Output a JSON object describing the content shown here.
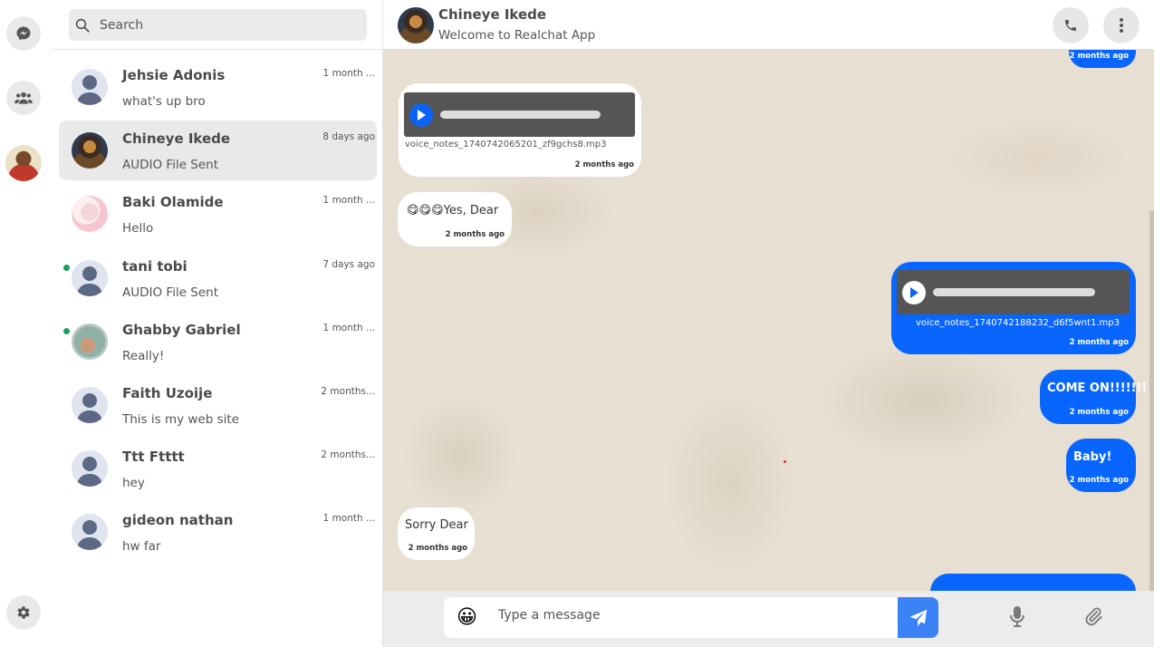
{
  "search": {
    "placeholder": "Search"
  },
  "contacts": [
    {
      "name": "Jehsie Adonis",
      "preview": "what's up bro",
      "time": "1 month ...",
      "online": false,
      "active": false
    },
    {
      "name": "Chineye Ikede",
      "preview": "AUDIO File Sent",
      "time": "8 days ago",
      "online": false,
      "active": true
    },
    {
      "name": "Baki Olamide",
      "preview": "Hello",
      "time": "1 month ...",
      "online": false,
      "active": false
    },
    {
      "name": "tani tobi",
      "preview": "AUDIO File Sent",
      "time": "7 days ago",
      "online": true,
      "active": false
    },
    {
      "name": "Ghabby Gabriel",
      "preview": "Really!",
      "time": "1 month ...",
      "online": true,
      "active": false
    },
    {
      "name": "Faith Uzoije",
      "preview": "This is my web site",
      "time": "2 months...",
      "online": false,
      "active": false
    },
    {
      "name": "Ttt Ftttt",
      "preview": "hey",
      "time": "2 months...",
      "online": false,
      "active": false
    },
    {
      "name": "gideon nathan",
      "preview": "hw far",
      "time": "1 month ...",
      "online": false,
      "active": false
    }
  ],
  "chat": {
    "name": "Chineye Ikede",
    "subtitle": "Welcome to Realchat App"
  },
  "messages": [
    {
      "direction": "out",
      "type": "text",
      "text": "",
      "time": "2 months ago"
    },
    {
      "direction": "in",
      "type": "audio",
      "filename": "voice_notes_1740742065201_zf9gchs8.mp3",
      "time": "2 months ago"
    },
    {
      "direction": "in",
      "type": "text",
      "text": "😋😋😋Yes, Dear",
      "time": "2 months ago"
    },
    {
      "direction": "out",
      "type": "audio",
      "filename": "voice_notes_1740742188232_d6f5wnt1.mp3",
      "time": "2 months ago"
    },
    {
      "direction": "out",
      "type": "text",
      "text": "COME ON!!!!!!!",
      "time": "2 months ago"
    },
    {
      "direction": "out",
      "type": "text",
      "text": "Baby!",
      "time": "2 months ago"
    },
    {
      "direction": "in",
      "type": "text",
      "text": "Sorry Dear",
      "time": "2 months ago"
    }
  ],
  "composer": {
    "placeholder": "Type a message",
    "emoji": "😀"
  },
  "colors": {
    "accent": "#0866ff",
    "send": "#3b82f6",
    "online": "#1e9e62"
  }
}
